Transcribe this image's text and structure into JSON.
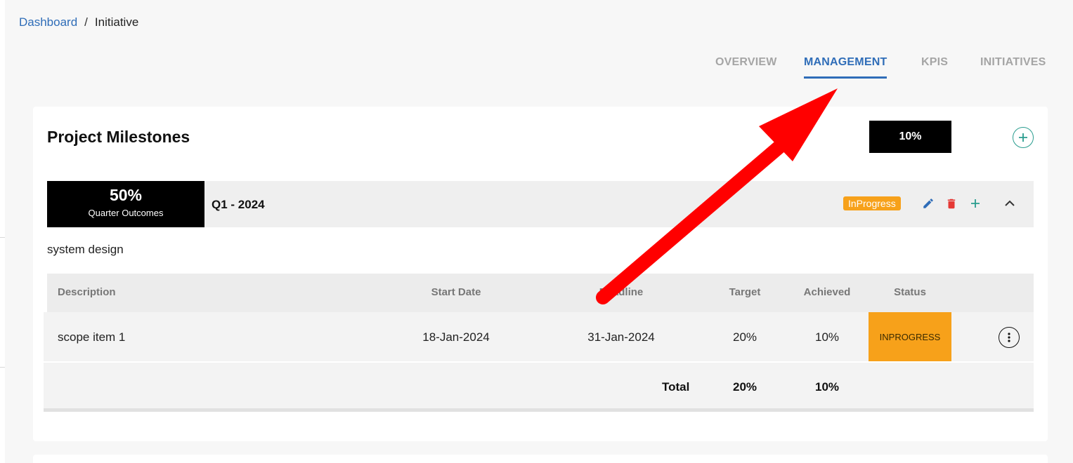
{
  "breadcrumb": {
    "link": "Dashboard",
    "separator": "/",
    "current": "Initiative"
  },
  "tabs": [
    {
      "label": "OVERVIEW",
      "active": false
    },
    {
      "label": "MANAGEMENT",
      "active": true
    },
    {
      "label": "KPIS",
      "active": false
    },
    {
      "label": "INITIATIVES",
      "active": false
    }
  ],
  "milestones": {
    "title": "Project Milestones",
    "overall_progress": "10%",
    "add_icon": "plus-circle-icon"
  },
  "quarter": {
    "percent": "50%",
    "percent_label": "Quarter Outcomes",
    "name": "Q1 - 2024",
    "status": "InProgress",
    "status_color": "#f7a11a",
    "icons": [
      "edit-icon",
      "delete-icon",
      "plus-icon",
      "chevron-up-icon"
    ],
    "description": "system design"
  },
  "table": {
    "headers": {
      "description": "Description",
      "start_date": "Start Date",
      "deadline": "Deadline",
      "target": "Target",
      "achieved": "Achieved",
      "status": "Status"
    },
    "rows": [
      {
        "description": "scope item 1",
        "start_date": "18-Jan-2024",
        "deadline": "31-Jan-2024",
        "target": "20%",
        "achieved": "10%",
        "status": "INPROGRESS"
      }
    ],
    "total": {
      "label": "Total",
      "target": "20%",
      "achieved": "10%"
    }
  },
  "colors": {
    "accent": "#2f6db8",
    "status_orange": "#f7a11a",
    "teal": "#2a9d8f",
    "delete_red": "#e53935",
    "annotation_arrow": "#ff0000"
  }
}
